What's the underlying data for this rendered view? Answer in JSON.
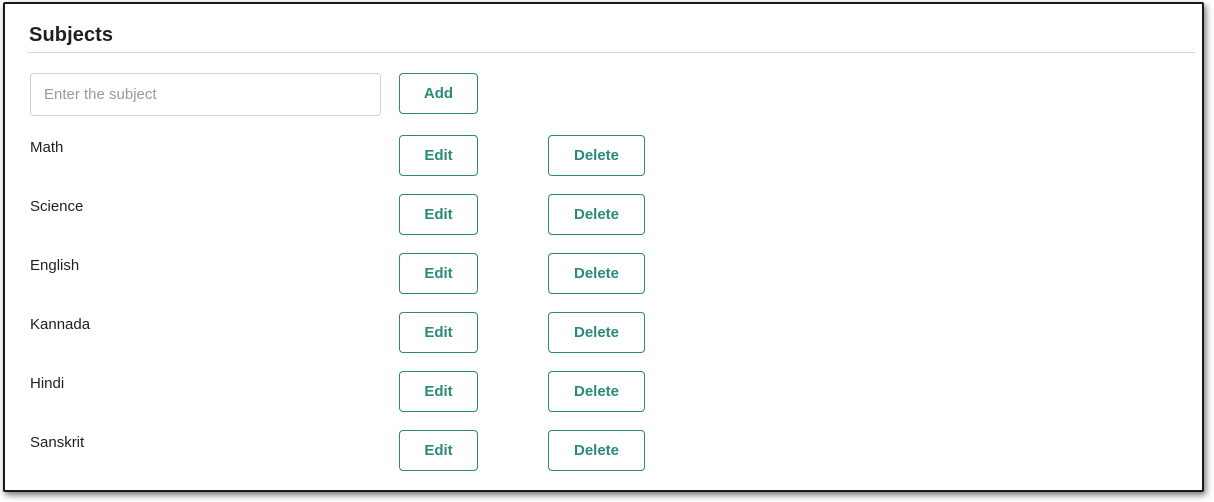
{
  "header": {
    "title": "Subjects"
  },
  "add_form": {
    "input_value": "",
    "input_placeholder": "Enter the subject",
    "add_label": "Add"
  },
  "subjects": [
    {
      "name": "Math",
      "edit_label": "Edit",
      "delete_label": "Delete"
    },
    {
      "name": "Science",
      "edit_label": "Edit",
      "delete_label": "Delete"
    },
    {
      "name": "English",
      "edit_label": "Edit",
      "delete_label": "Delete"
    },
    {
      "name": "Kannada",
      "edit_label": "Edit",
      "delete_label": "Delete"
    },
    {
      "name": "Hindi",
      "edit_label": "Edit",
      "delete_label": "Delete"
    },
    {
      "name": "Sanskrit",
      "edit_label": "Edit",
      "delete_label": "Delete"
    }
  ],
  "colors": {
    "accent": "#2b8a78",
    "text": "#1f1f1f",
    "divider": "#d6d6d6",
    "input_border": "#d0d0d0"
  }
}
